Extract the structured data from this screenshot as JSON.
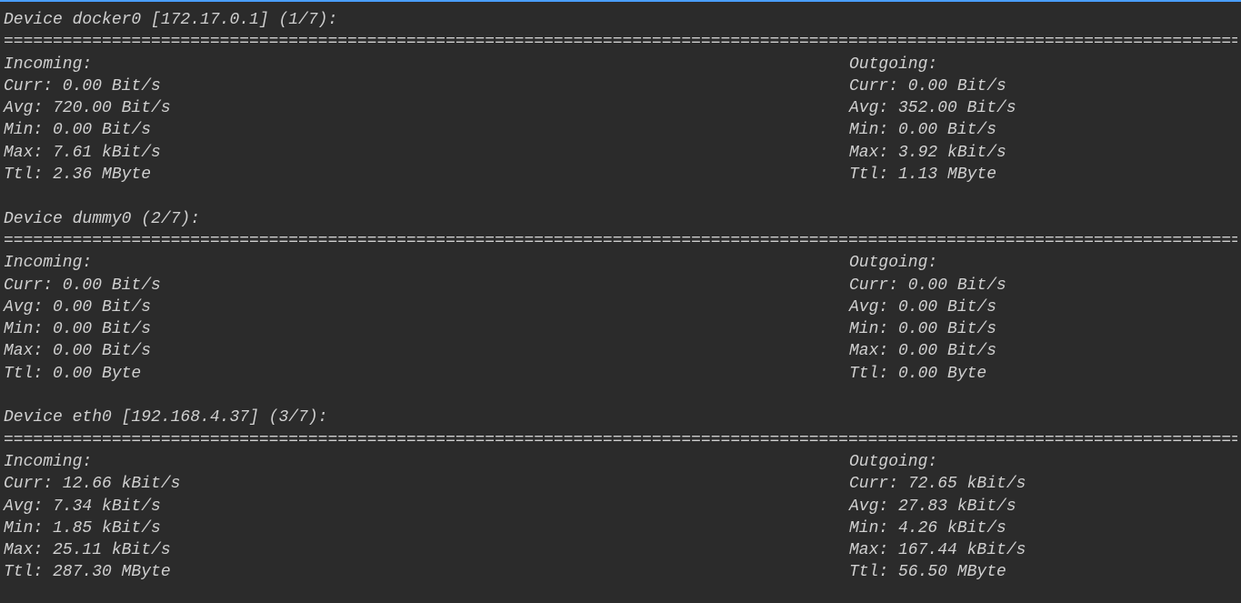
{
  "divider": "==============================================================================================================================================",
  "devices": [
    {
      "header": "Device docker0 [172.17.0.1] (1/7):",
      "incoming": {
        "title": "Incoming:",
        "curr": "Curr: 0.00 Bit/s",
        "avg": "Avg: 720.00 Bit/s",
        "min": "Min: 0.00 Bit/s",
        "max": "Max: 7.61 kBit/s",
        "ttl": "Ttl: 2.36 MByte"
      },
      "outgoing": {
        "title": "Outgoing:",
        "curr": "Curr: 0.00 Bit/s",
        "avg": "Avg: 352.00 Bit/s",
        "min": "Min: 0.00 Bit/s",
        "max": "Max: 3.92 kBit/s",
        "ttl": "Ttl: 1.13 MByte"
      }
    },
    {
      "header": "Device dummy0 (2/7):",
      "incoming": {
        "title": "Incoming:",
        "curr": "Curr: 0.00 Bit/s",
        "avg": "Avg: 0.00 Bit/s",
        "min": "Min: 0.00 Bit/s",
        "max": "Max: 0.00 Bit/s",
        "ttl": "Ttl: 0.00 Byte"
      },
      "outgoing": {
        "title": "Outgoing:",
        "curr": "Curr: 0.00 Bit/s",
        "avg": "Avg: 0.00 Bit/s",
        "min": "Min: 0.00 Bit/s",
        "max": "Max: 0.00 Bit/s",
        "ttl": "Ttl: 0.00 Byte"
      }
    },
    {
      "header": "Device eth0 [192.168.4.37] (3/7):",
      "incoming": {
        "title": "Incoming:",
        "curr": "Curr: 12.66 kBit/s",
        "avg": "Avg: 7.34 kBit/s",
        "min": "Min: 1.85 kBit/s",
        "max": "Max: 25.11 kBit/s",
        "ttl": "Ttl: 287.30 MByte"
      },
      "outgoing": {
        "title": "Outgoing:",
        "curr": "Curr: 72.65 kBit/s",
        "avg": "Avg: 27.83 kBit/s",
        "min": "Min: 4.26 kBit/s",
        "max": "Max: 167.44 kBit/s",
        "ttl": "Ttl: 56.50 MByte"
      }
    }
  ]
}
